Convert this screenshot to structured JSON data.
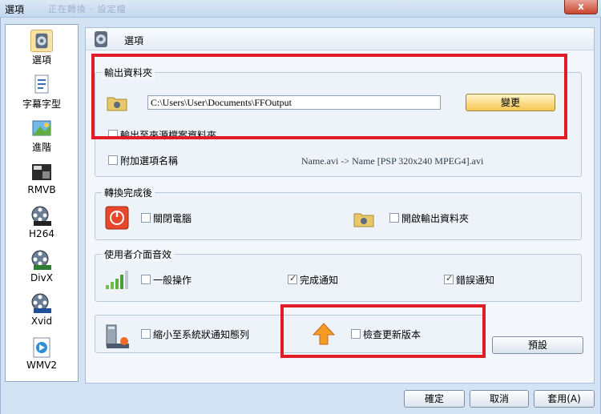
{
  "window": {
    "title": "選項",
    "ghost_title": "正在轉換 · 設定檔",
    "close_label": "x"
  },
  "sidebar": {
    "items": [
      {
        "label": "選項",
        "icon": "options-icon"
      },
      {
        "label": "字幕字型",
        "icon": "subtitle-font-icon"
      },
      {
        "label": "進階",
        "icon": "advanced-icon"
      },
      {
        "label": "RMVB",
        "icon": "rmvb-icon"
      },
      {
        "label": "H264",
        "icon": "h264-icon"
      },
      {
        "label": "DivX",
        "icon": "divx-icon"
      },
      {
        "label": "Xvid",
        "icon": "xvid-icon"
      },
      {
        "label": "WMV2",
        "icon": "wmv2-icon"
      }
    ]
  },
  "content": {
    "title": "選項"
  },
  "output": {
    "group_title": "輸出資料夾",
    "path": "C:\\Users\\User\\Documents\\FFOutput",
    "change_label": "變更",
    "source_folder_label": "輸出至來源檔案資料夾",
    "append_label": "附加選項名稱",
    "example": "Name.avi -> Name [PSP 320x240 MPEG4].avi"
  },
  "after": {
    "group_title": "轉換完成後",
    "shutdown_label": "關閉電腦",
    "open_folder_label": "開啟輸出資料夾"
  },
  "sound": {
    "group_title": "使用者介面音效",
    "general_label": "一般操作",
    "done_label": "完成通知",
    "error_label": "錯誤通知",
    "general_checked": false,
    "done_checked": true,
    "error_checked": true
  },
  "misc": {
    "tray_label": "縮小至系統狀通知態列",
    "update_label": "檢查更新版本",
    "default_label": "預設"
  },
  "footer": {
    "ok_label": "確定",
    "cancel_label": "取消",
    "apply_label": "套用(A)"
  },
  "colors": {
    "highlight_red": "#e01c26",
    "accent_yellow": "#f4c753"
  }
}
